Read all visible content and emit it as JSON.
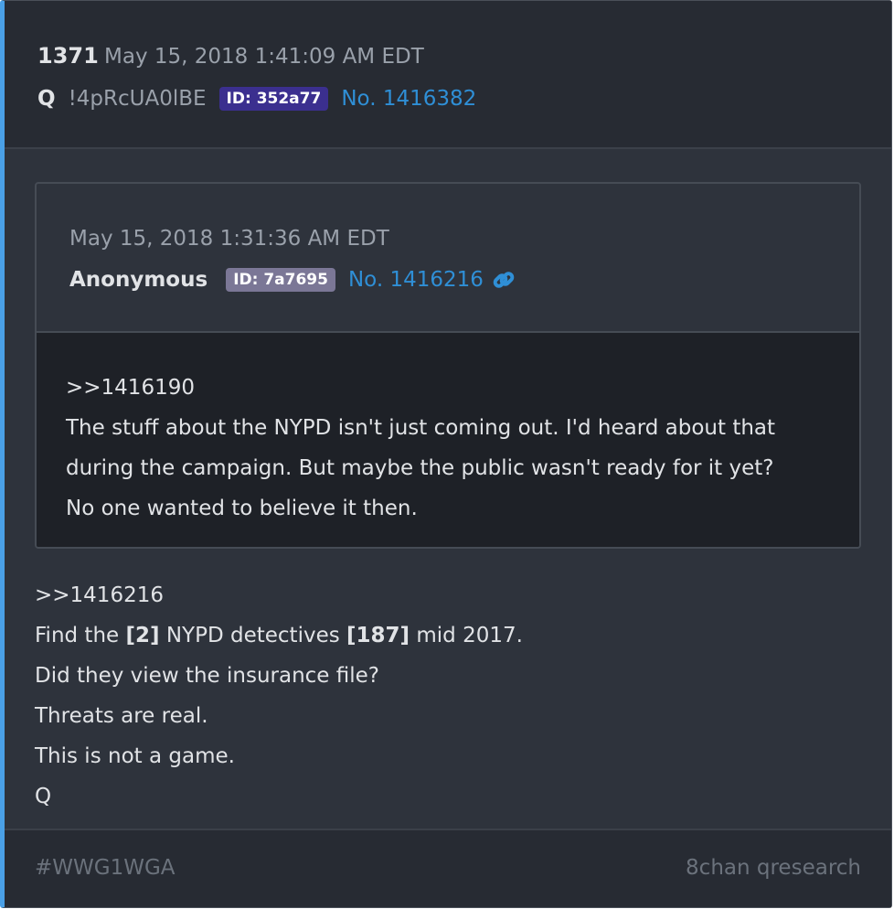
{
  "post": {
    "number": "1371",
    "date": "May 15, 2018 1:41:09 AM EDT",
    "author": "Q",
    "tripcode": "!4pRcUA0lBE",
    "id_label": "ID: 352a77",
    "id_color": "#3b2f8f",
    "post_link": "No. 1416382"
  },
  "quoted": {
    "date": "May 15, 2018 1:31:36 AM EDT",
    "author": "Anonymous",
    "id_label": "ID: 7a7695",
    "id_color": "#7b7796",
    "post_link": "No. 1416216",
    "icon": "link-icon",
    "lines": [
      ">>1416190",
      "The stuff about the NYPD isn't just coming out.  I'd heard about that",
      "during the campaign.  But maybe the public wasn't ready for it yet?",
      "No one wanted to believe it then."
    ]
  },
  "body": {
    "line1": ">>1416216",
    "line2_a": "Find the ",
    "line2_b": "[2]",
    "line2_c": " NYPD detectives ",
    "line2_d": "[187]",
    "line2_e": " mid 2017.",
    "line3": "Did they view the insurance file?",
    "line4": "Threats are real.",
    "line5": "This is not a game.",
    "line6": "Q"
  },
  "footer": {
    "hashtag": "#WWG1WGA",
    "source": "8chan qresearch"
  },
  "colors": {
    "accent": "#4aa0e6",
    "link": "#2f8fd6",
    "background": "#2e333c",
    "header_bg": "#272b33",
    "quote_body_bg": "#1e2127"
  }
}
